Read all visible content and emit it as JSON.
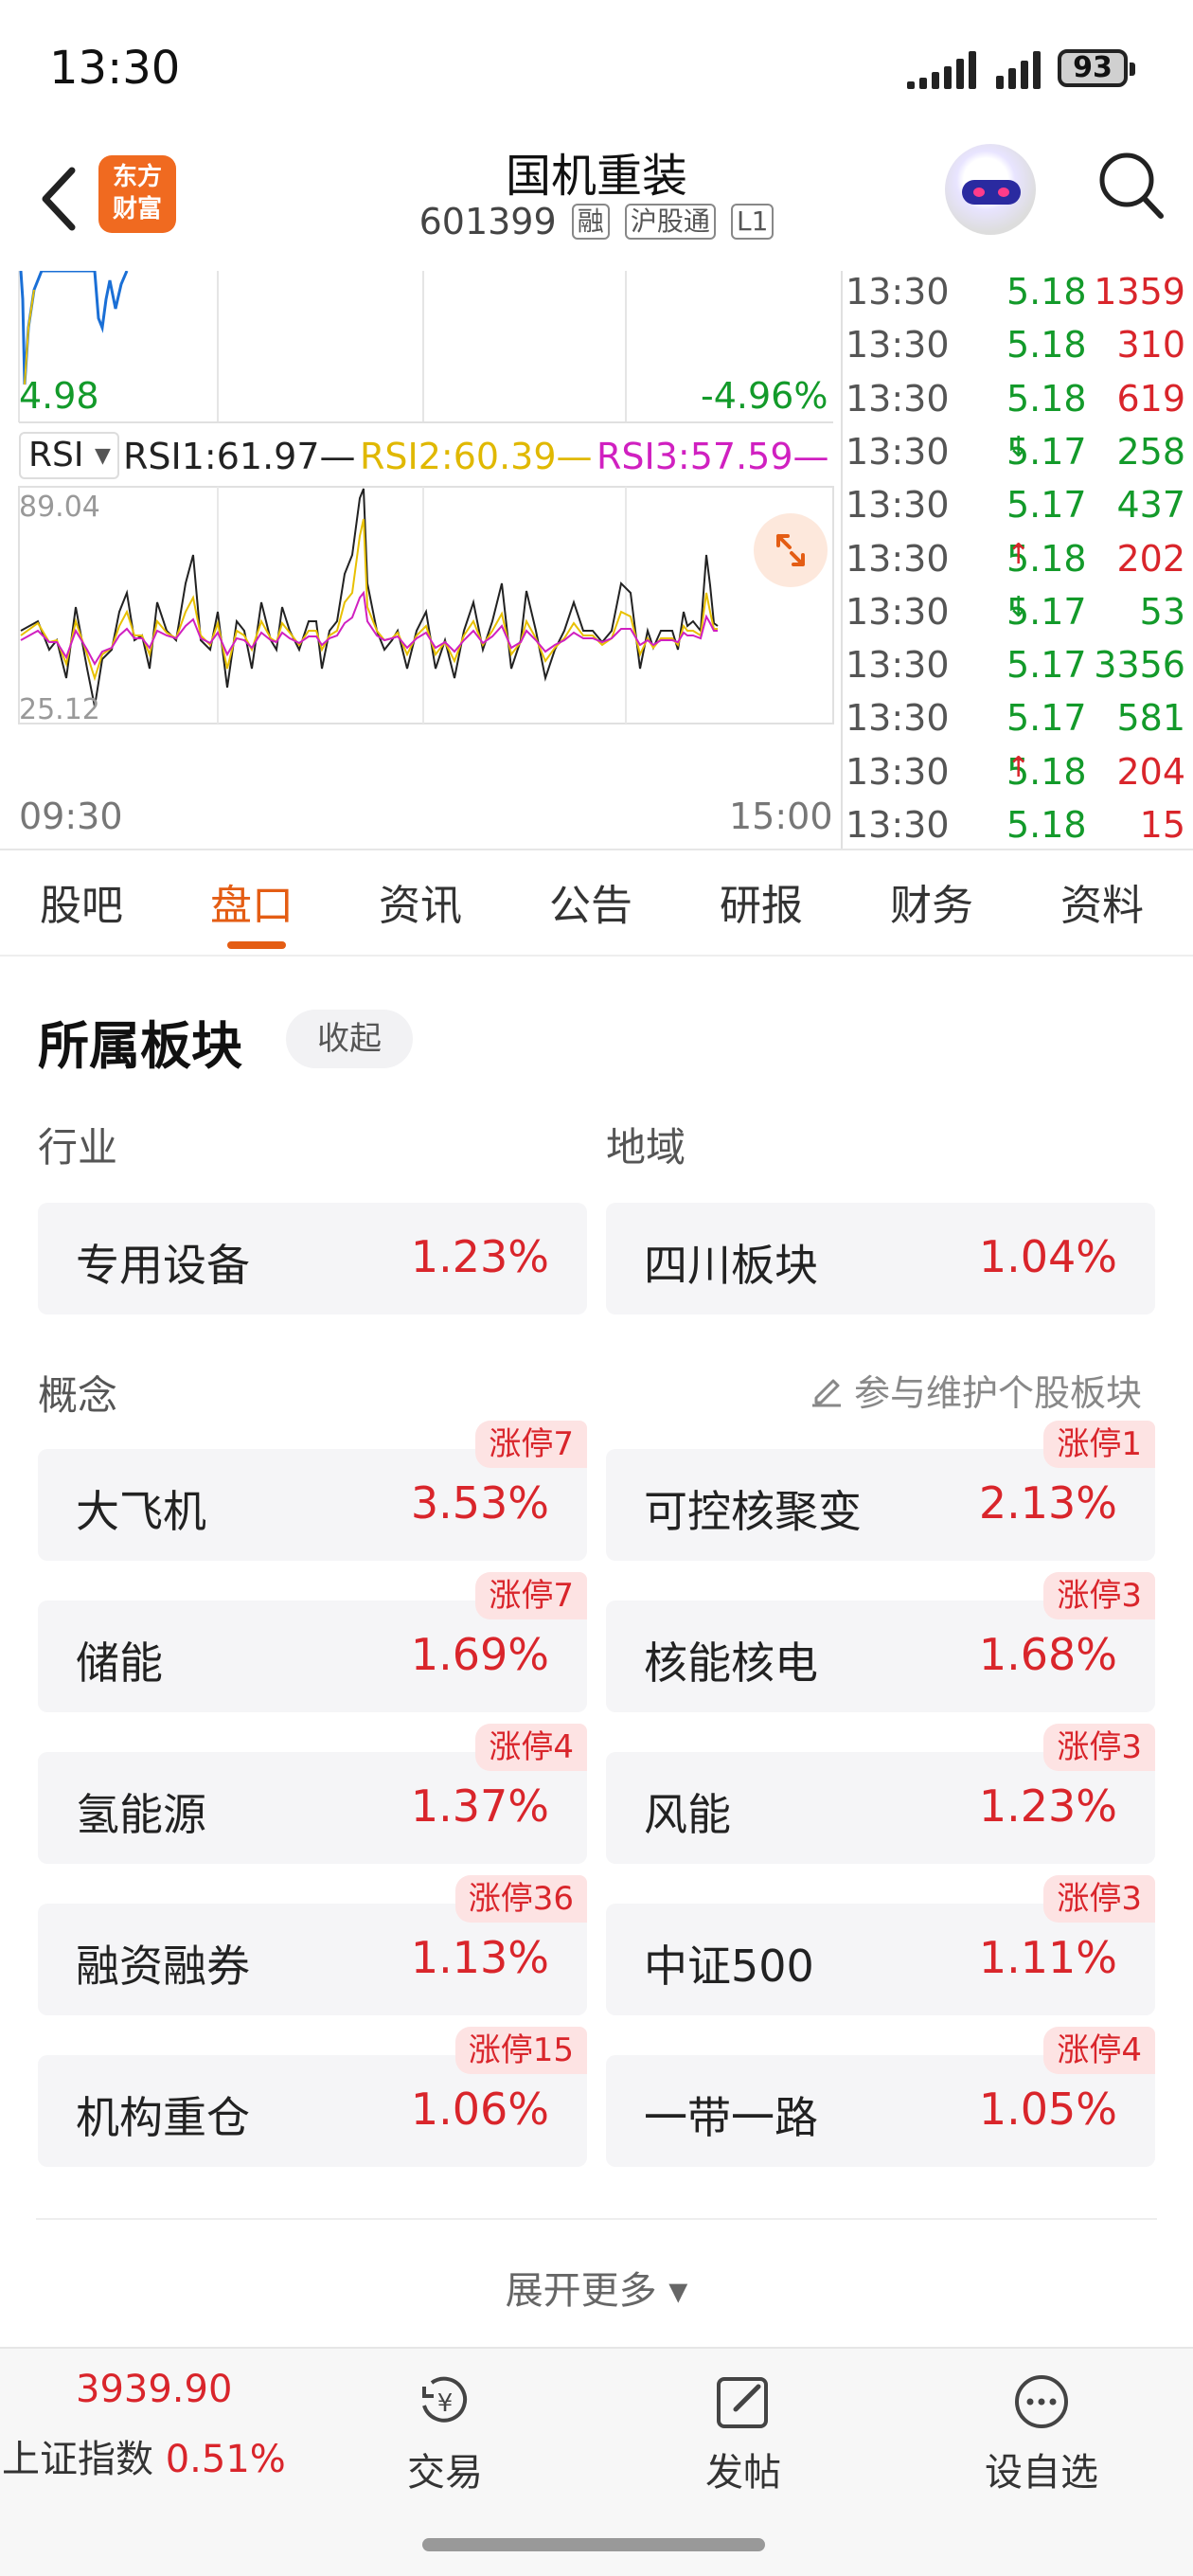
{
  "status_bar": {
    "time": "13:30",
    "battery": "93"
  },
  "header": {
    "logo_text": "东方\n财富",
    "stock_name": "国机重装",
    "stock_code": "601399",
    "tags": [
      "融",
      "沪股通",
      "L1"
    ]
  },
  "chart": {
    "price_low_label": "4.98",
    "change_label": "-4.96%",
    "indicator": "RSI",
    "rsi1": "RSI1:61.97—",
    "rsi2": "RSI2:60.39—",
    "rsi3": "RSI3:57.59—",
    "rsi_max": "89.04",
    "rsi_min": "25.12",
    "time_start": "09:30",
    "time_end": "15:00",
    "colors": {
      "rsi1": "#222222",
      "rsi2": "#e8c000",
      "rsi3": "#d020c0",
      "price": "#1a6fd6"
    }
  },
  "ticks": [
    {
      "time": "13:30",
      "price": "5.18",
      "arrow": "",
      "vol": "1359",
      "dir": "up"
    },
    {
      "time": "13:30",
      "price": "5.18",
      "arrow": "",
      "vol": "310",
      "dir": "up"
    },
    {
      "time": "13:30",
      "price": "5.18",
      "arrow": "",
      "vol": "619",
      "dir": "up"
    },
    {
      "time": "13:30",
      "price": "5.17",
      "arrow": "↓",
      "vol": "258",
      "dir": "down"
    },
    {
      "time": "13:30",
      "price": "5.17",
      "arrow": "",
      "vol": "437",
      "dir": "down"
    },
    {
      "time": "13:30",
      "price": "5.18",
      "arrow": "↑",
      "vol": "202",
      "dir": "up"
    },
    {
      "time": "13:30",
      "price": "5.17",
      "arrow": "↓",
      "vol": "53",
      "dir": "down"
    },
    {
      "time": "13:30",
      "price": "5.17",
      "arrow": "",
      "vol": "3356",
      "dir": "down"
    },
    {
      "time": "13:30",
      "price": "5.17",
      "arrow": "",
      "vol": "581",
      "dir": "down"
    },
    {
      "time": "13:30",
      "price": "5.18",
      "arrow": "↑",
      "vol": "204",
      "dir": "up"
    },
    {
      "time": "13:30",
      "price": "5.18",
      "arrow": "",
      "vol": "15",
      "dir": "up"
    }
  ],
  "tabs": [
    "股吧",
    "盘口",
    "资讯",
    "公告",
    "研报",
    "财务",
    "资料"
  ],
  "active_tab": "盘口",
  "sector": {
    "title": "所属板块",
    "collapse_label": "收起",
    "industry_label": "行业",
    "region_label": "地域",
    "industry": {
      "name": "专用设备",
      "pct": "1.23%"
    },
    "region": {
      "name": "四川板块",
      "pct": "1.04%"
    },
    "concept_label": "概念",
    "maintain_label": "参与维护个股板块",
    "concepts": [
      {
        "name": "大飞机",
        "pct": "3.53%",
        "badge": "涨停7"
      },
      {
        "name": "可控核聚变",
        "pct": "2.13%",
        "badge": "涨停1"
      },
      {
        "name": "储能",
        "pct": "1.69%",
        "badge": "涨停7"
      },
      {
        "name": "核能核电",
        "pct": "1.68%",
        "badge": "涨停3"
      },
      {
        "name": "氢能源",
        "pct": "1.37%",
        "badge": "涨停4"
      },
      {
        "name": "风能",
        "pct": "1.23%",
        "badge": "涨停3"
      },
      {
        "name": "融资融券",
        "pct": "1.13%",
        "badge": "涨停36"
      },
      {
        "name": "中证500",
        "pct": "1.11%",
        "badge": "涨停3"
      },
      {
        "name": "机构重仓",
        "pct": "1.06%",
        "badge": "涨停15"
      },
      {
        "name": "一带一路",
        "pct": "1.05%",
        "badge": "涨停4"
      }
    ],
    "expand_label": "展开更多 ▾"
  },
  "bottom_bar": {
    "index_value": "3939.90",
    "index_name": "上证指数",
    "index_pct": "0.51%",
    "trade_label": "交易",
    "post_label": "发帖",
    "watchlist_label": "设自选"
  }
}
